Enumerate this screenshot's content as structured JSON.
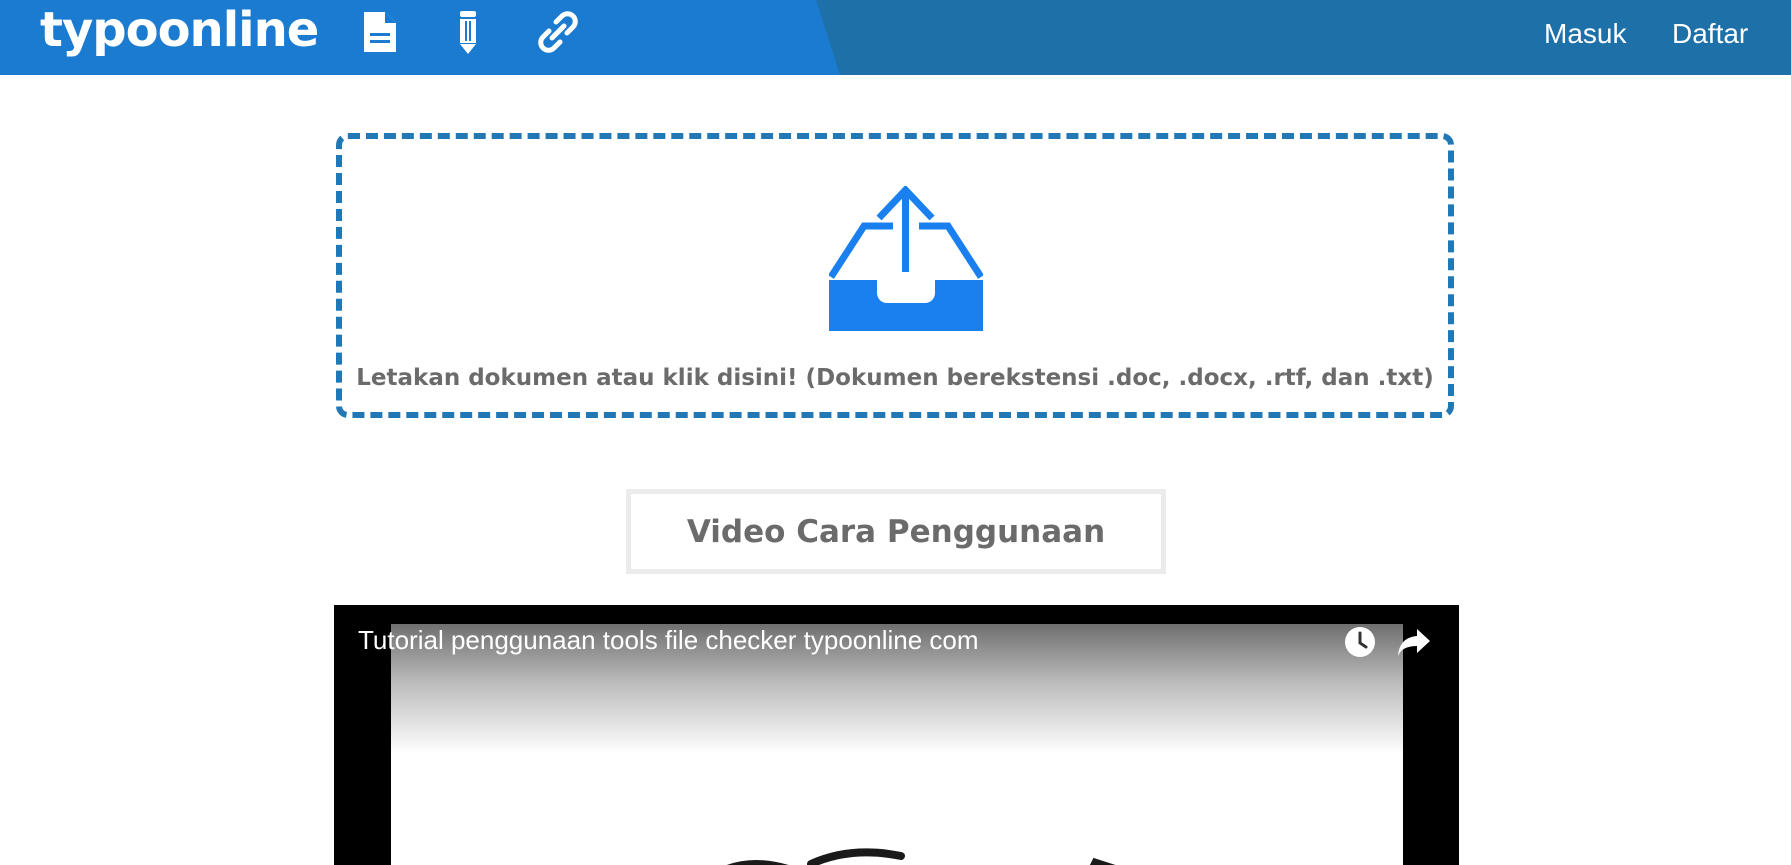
{
  "header": {
    "logo_text": "typoonline",
    "icons": [
      "document-icon",
      "pencil-icon",
      "link-icon"
    ],
    "nav": {
      "login_label": "Masuk",
      "register_label": "Daftar"
    },
    "colors": {
      "bar": "#1e70a9",
      "accent": "#1a7bd1"
    }
  },
  "upload": {
    "icon": "upload-tray-icon",
    "instruction": "Letakan dokumen atau klik disini! (Dokumen berekstensi .doc, .docx, .rtf, dan .txt)",
    "border_color": "#2278b5",
    "icon_color": "#1a80f0"
  },
  "video_button": {
    "label": "Video Cara Penggunaan"
  },
  "video": {
    "title": "Tutorial penggunaan tools file checker typoonline com",
    "controls": [
      "watch-later-icon",
      "share-icon"
    ]
  }
}
